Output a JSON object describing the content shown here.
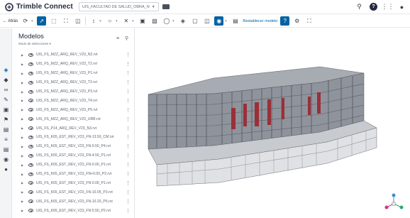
{
  "header": {
    "brand": "Trimble Connect",
    "project": "UIS_FACULTAD DE SALUD_OBRA_N",
    "icons": [
      "trimble-logo-icon",
      "folder-icon",
      "search-icon",
      "help-icon",
      "apps-grid-icon",
      "user-icon"
    ]
  },
  "toolbar": {
    "back_label": "← Atrás",
    "reset_label": "Restablecer modelo",
    "icons": [
      "orbit-icon",
      "select-icon",
      "box-select-icon",
      "fit-icon",
      "section-icon",
      "measure-icon",
      "markup-icon",
      "explode-icon",
      "clip-icon",
      "presentation-icon",
      "view-icon",
      "layers-icon",
      "camera-icon",
      "properties-icon",
      "visibility-icon",
      "reset-icon",
      "help-icon",
      "settings-icon",
      "fullscreen-icon"
    ]
  },
  "panel": {
    "title": "Modelos",
    "subtitle": "Modo de selecciones ▾",
    "files": [
      "UIS_FS_MZZ_ARQ_REV_V23_N2.rvt",
      "UIS_FS_MZZ_ARQ_REV_V23_T2.rvt",
      "UIS_FS_MZZ_ARQ_REV_V23_P1.rvt",
      "UIS_FS_MZZ_ARQ_REV_V23_T2.rvt",
      "UIS_FS_MZZ_ARQ_REV_V23_P3.rvt",
      "UIS_FS_MZZ_ARQ_REV_V23_T4.rvt",
      "UIS_FS_MZZ_ARQ_REV_V23_P5.rvt",
      "UIS_FS_MZZ_ARQ_REV_V23_URB.rvt",
      "UIS_FS_P14_ARQ_REV_V23_N3.rvt",
      "UIS_FS_K65_EST_REV_V23_FN-13.50_CM.rvt",
      "UIS_FS_K65_EST_REV_V23_FN-9.50_P4.rvt",
      "UIS_FS_K65_EST_REV_V23_FN-4.50_P1.rvt",
      "UIS_FS_K65_EST_REV_V23_FN-0.00_P1.rvt",
      "UIS_FS_K65_EST_REV_V23_FN+0.00_P2.rvt",
      "UIS_FS_K65_EST_REV_V23_FN-0.00_P1.rvt",
      "UIS_FS_K65_EST_REV_V23_FN-10.05_P3.rvt",
      "UIS_FS_K65_EST_REV_V23_FN-10.20_P5.rvt",
      "UIS_FS_K65_EST_REV_V23_FN-5.50_P2.rvt"
    ]
  },
  "colors": {
    "accent": "#0063a3",
    "brand_text": "#252a3f",
    "model_gray": "#8f939b",
    "model_red": "#9b2f38"
  }
}
